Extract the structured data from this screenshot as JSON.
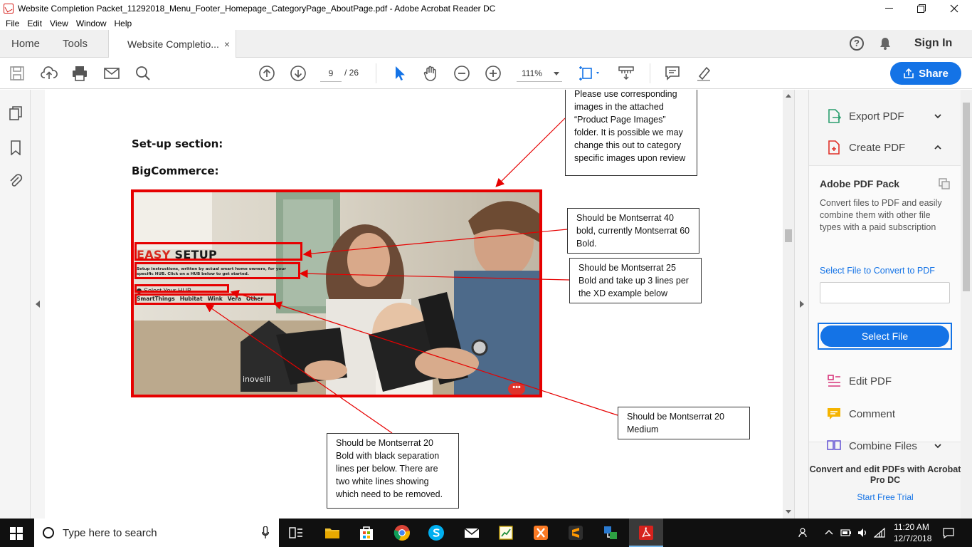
{
  "window": {
    "title": "Website Completion Packet_11292018_Menu_Footer_Homepage_CategoryPage_AboutPage.pdf - Adobe Acrobat Reader DC"
  },
  "menu": [
    "File",
    "Edit",
    "View",
    "Window",
    "Help"
  ],
  "tabs": {
    "home": "Home",
    "tools": "Tools",
    "document": "Website Completio...",
    "close": "×",
    "sign_in": "Sign In",
    "help": "?"
  },
  "toolbar": {
    "page_current": "9",
    "page_total": "/ 26",
    "zoom": "111%",
    "share": "Share"
  },
  "document": {
    "heading1": "Set-up section:",
    "heading2": "BigCommerce:",
    "top_callout": "Please use corresponding images in the attached “Product Page Images” folder. It is possible we may change this out to category specific images upon review",
    "callout_title": "Should be Montserrat 40 bold, currently Montserrat 60 Bold.",
    "callout_sub": "Should be Montserrat 25 Bold and take up 3 lines per the XD example below",
    "callout_hubs": "Should be Montserrat 20 Medium",
    "callout_nav": "Should be Montserrat 20 Bold with black separation lines per below. There are two white lines showing which need to be removed.",
    "shot": {
      "title_accent": "EASY",
      "title_rest": "SETUP",
      "subtitle": "Setup instructions, written by actual smart home owners, for your specific HUB. Click on a HUB below to get started.",
      "select_hub": "Select Your HUB",
      "hubs": [
        "SmartThings",
        "Hubitat",
        "Wink",
        "Vera",
        "Other"
      ],
      "brand": "inovelli",
      "chat": "•••"
    }
  },
  "right_panel": {
    "export_pdf": "Export PDF",
    "create_pdf": "Create PDF",
    "pack_title": "Adobe PDF Pack",
    "pack_desc": "Convert files to PDF and easily combine them with other file types with a paid subscription",
    "select_link": "Select File to Convert to PDF",
    "select_button": "Select File",
    "edit_pdf": "Edit PDF",
    "comment": "Comment",
    "combine_files": "Combine Files",
    "promo": "Convert and edit PDFs with Acrobat Pro DC",
    "trial": "Start Free Trial"
  },
  "taskbar": {
    "search_placeholder": "Type here to search",
    "time": "11:20 AM",
    "date": "12/7/2018"
  },
  "colors": {
    "accent": "#1473e6",
    "annotation_red": "#e60000",
    "acrobat_red": "#d6221d"
  }
}
